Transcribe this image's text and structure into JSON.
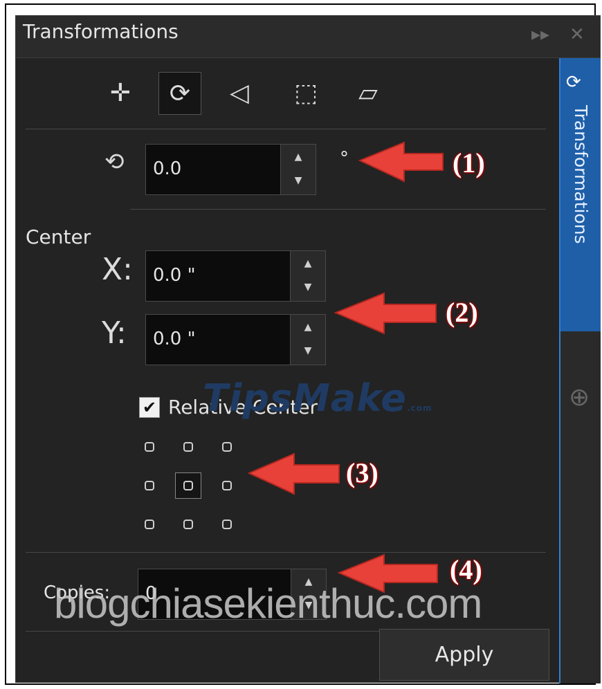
{
  "panel": {
    "title": "Transformations",
    "collapse_icon": "double-chevron-right",
    "close_icon": "close"
  },
  "toolbar": {
    "tools": [
      {
        "name": "position",
        "glyph": "✛"
      },
      {
        "name": "rotate",
        "glyph": "⟳",
        "active": true
      },
      {
        "name": "scale-mirror",
        "glyph": "◁"
      },
      {
        "name": "size",
        "glyph": "⬚"
      },
      {
        "name": "skew",
        "glyph": "▱"
      }
    ]
  },
  "rotation": {
    "value": "0.0",
    "unit": "°"
  },
  "center": {
    "label": "Center",
    "x_label": "X:",
    "x_value": "0.0 \"",
    "y_label": "Y:",
    "y_value": "0.0 \""
  },
  "relative_center": {
    "label": "Relative Center",
    "checked": true
  },
  "anchor_grid": {
    "selected": "center"
  },
  "copies": {
    "label": "Copies:",
    "value": "0"
  },
  "apply": {
    "label": "Apply"
  },
  "side_tab": {
    "label": "Transformations"
  },
  "annotations": [
    "(1)",
    "(2)",
    "(3)",
    "(4)"
  ],
  "watermarks": {
    "logo": "TipsMake",
    "logo_suffix": ".com",
    "blog": "blogchiasekienthuc.com"
  },
  "colors": {
    "panel_bg": "#232323",
    "side_tab_bg": "#1f5fa8",
    "arrow": "#e8413a"
  }
}
